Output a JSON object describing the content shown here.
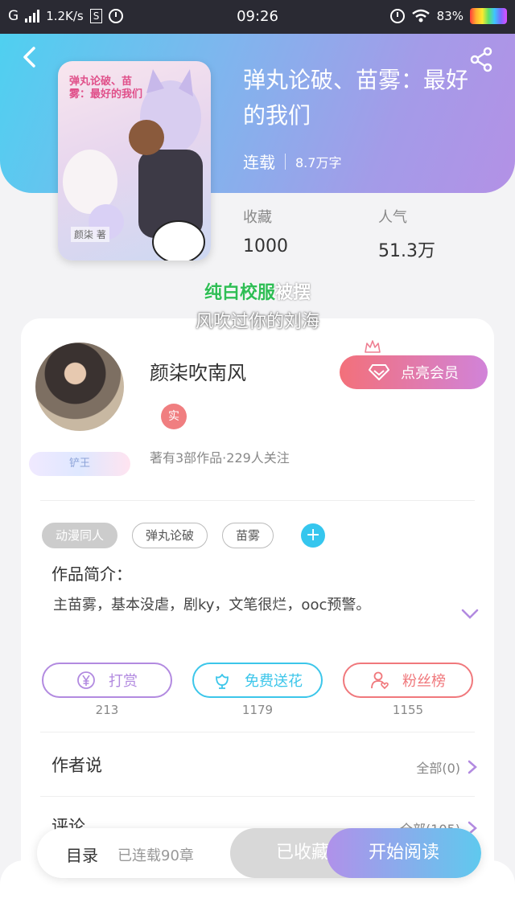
{
  "status_bar": {
    "carrier": "G",
    "speed": "1.2K/s",
    "box_icon": "S",
    "time": "09:26",
    "battery": "83%"
  },
  "book": {
    "cover_title": "弹丸论破、苗雾：最好的我们",
    "cover_author": "颜柒 著",
    "title": "弹丸论破、苗雾：最好的我们",
    "status": "连载",
    "word_count": "8.7万字",
    "stats": [
      {
        "label": "收藏",
        "value": "1000"
      },
      {
        "label": "人气",
        "value": "51.3万"
      }
    ]
  },
  "overlay": {
    "line1_green": "纯白校服",
    "line1_white": "被摆",
    "line2": "风吹过你的刘海"
  },
  "author": {
    "name": "颜柒吹南风",
    "real_badge": "实",
    "badge_strip": "铲王",
    "meta": "著有3部作品·229人关注",
    "vip_button": "点亮会员"
  },
  "tags": [
    "动漫同人",
    "弹丸论破",
    "苗雾"
  ],
  "intro": {
    "label": "作品简介：",
    "text": "主苗雾，基本没虐，剧ky，文笔很烂，ooc预警。"
  },
  "actions": [
    {
      "label": "打赏",
      "count": "213",
      "color": "#b28ae0",
      "icon": "yen-icon"
    },
    {
      "label": "免费送花",
      "count": "1179",
      "color": "#3cc6ea",
      "icon": "flower-icon"
    },
    {
      "label": "粉丝榜",
      "count": "1155",
      "color": "#f0787c",
      "icon": "fans-icon"
    }
  ],
  "rows": [
    {
      "label": "作者说",
      "right": "全部(0)"
    },
    {
      "label": "评论",
      "right": "全部(105)"
    }
  ],
  "bottom_bar": {
    "toc": "目录",
    "chapters": "已连载90章",
    "favorited": "已收藏",
    "read": "开始阅读"
  },
  "colors": {
    "header_start": "#4fd0f0",
    "header_end": "#b391e6",
    "accent_blue": "#35c6ee"
  }
}
